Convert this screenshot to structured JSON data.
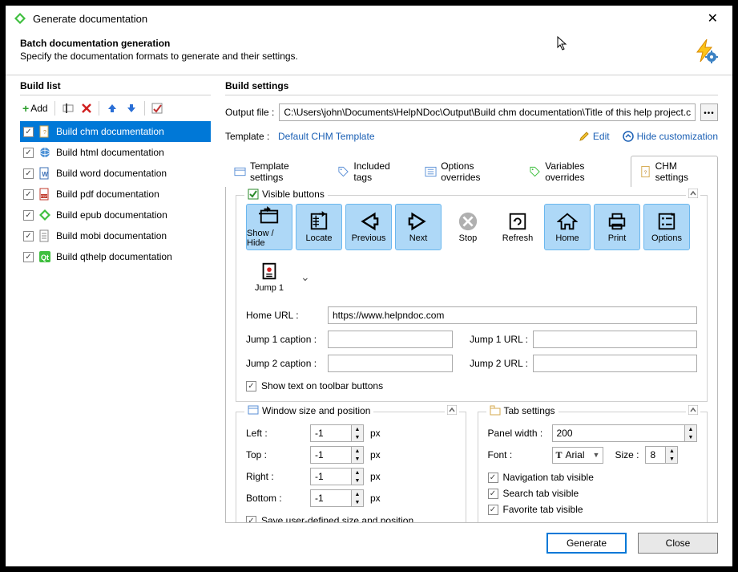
{
  "window": {
    "title": "Generate documentation"
  },
  "header": {
    "title": "Batch documentation generation",
    "subtitle": "Specify the documentation formats to generate and their settings."
  },
  "build_list": {
    "title": "Build list",
    "add_label": "Add",
    "items": [
      {
        "label": "Build chm documentation",
        "checked": true,
        "selected": true,
        "icon": "chm"
      },
      {
        "label": "Build html documentation",
        "checked": true,
        "selected": false,
        "icon": "html"
      },
      {
        "label": "Build word documentation",
        "checked": true,
        "selected": false,
        "icon": "word"
      },
      {
        "label": "Build pdf documentation",
        "checked": true,
        "selected": false,
        "icon": "pdf"
      },
      {
        "label": "Build epub documentation",
        "checked": true,
        "selected": false,
        "icon": "epub"
      },
      {
        "label": "Build mobi documentation",
        "checked": true,
        "selected": false,
        "icon": "mobi"
      },
      {
        "label": "Build qthelp documentation",
        "checked": true,
        "selected": false,
        "icon": "qthelp"
      }
    ]
  },
  "build_settings": {
    "title": "Build settings",
    "output_label": "Output file :",
    "output_value": "C:\\Users\\john\\Documents\\HelpNDoc\\Output\\Build chm documentation\\Title of this help project.chm",
    "template_label": "Template :",
    "template_value": "Default CHM Template",
    "edit_label": "Edit",
    "hide_custom_label": "Hide customization"
  },
  "tabs": {
    "items": [
      {
        "label": "Template settings",
        "icon": "template",
        "active": false
      },
      {
        "label": "Included tags",
        "icon": "tags",
        "active": false
      },
      {
        "label": "Options overrides",
        "icon": "options",
        "active": false
      },
      {
        "label": "Variables overrides",
        "icon": "variables",
        "active": false
      },
      {
        "label": "CHM settings",
        "icon": "chm",
        "active": true
      }
    ]
  },
  "visible_buttons": {
    "legend": "Visible buttons",
    "buttons": [
      {
        "label": "Show / Hide",
        "selected": true,
        "icon": "showhide"
      },
      {
        "label": "Locate",
        "selected": true,
        "icon": "locate"
      },
      {
        "label": "Previous",
        "selected": true,
        "icon": "previous"
      },
      {
        "label": "Next",
        "selected": true,
        "icon": "next"
      },
      {
        "label": "Stop",
        "selected": false,
        "icon": "stop"
      },
      {
        "label": "Refresh",
        "selected": false,
        "icon": "refresh"
      },
      {
        "label": "Home",
        "selected": true,
        "icon": "home"
      },
      {
        "label": "Print",
        "selected": true,
        "icon": "print"
      },
      {
        "label": "Options",
        "selected": true,
        "icon": "options"
      },
      {
        "label": "Jump 1",
        "selected": false,
        "icon": "jump"
      }
    ],
    "home_url_label": "Home URL :",
    "home_url_value": "https://www.helpndoc.com",
    "jump1_caption_label": "Jump 1 caption :",
    "jump1_caption_value": "",
    "jump1_url_label": "Jump 1 URL :",
    "jump1_url_value": "",
    "jump2_caption_label": "Jump 2 caption :",
    "jump2_caption_value": "",
    "jump2_url_label": "Jump 2 URL :",
    "jump2_url_value": "",
    "show_text_label": "Show text on toolbar buttons",
    "show_text_checked": true
  },
  "window_pos": {
    "legend": "Window size and position",
    "left_label": "Left :",
    "left_value": "-1",
    "top_label": "Top :",
    "top_value": "-1",
    "right_label": "Right :",
    "right_value": "-1",
    "bottom_label": "Bottom :",
    "bottom_value": "-1",
    "unit": "px",
    "save_label": "Save user-defined size and position",
    "save_checked": true
  },
  "tab_settings": {
    "legend": "Tab settings",
    "panel_width_label": "Panel width :",
    "panel_width_value": "200",
    "font_label": "Font :",
    "font_value": "Arial",
    "size_label": "Size :",
    "size_value": "8",
    "nav_label": "Navigation tab visible",
    "nav_checked": true,
    "search_label": "Search tab visible",
    "search_checked": true,
    "fav_label": "Favorite tab visible",
    "fav_checked": true
  },
  "footer": {
    "generate": "Generate",
    "close": "Close"
  }
}
